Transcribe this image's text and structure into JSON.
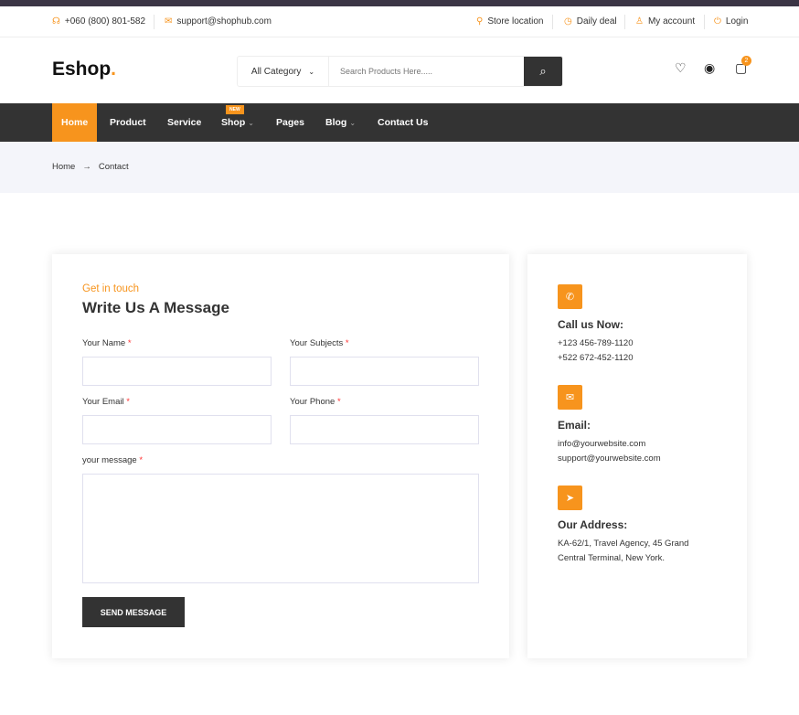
{
  "topbar": {
    "phone": "+060 (800) 801-582",
    "email": "support@shophub.com",
    "store": "Store location",
    "deal": "Daily deal",
    "account": "My account",
    "login": "Login"
  },
  "header": {
    "logo": "Eshop",
    "logo_dot": ".",
    "category": "All Category",
    "search_placeholder": "Search Products Here.....",
    "cart_count": "2"
  },
  "nav": {
    "items": [
      "Home",
      "Product",
      "Service",
      "Shop",
      "Pages",
      "Blog",
      "Contact Us"
    ],
    "new_badge": "NEW"
  },
  "breadcrumb": {
    "home": "Home",
    "sep": "→",
    "current": "Contact"
  },
  "form": {
    "kicker": "Get in touch",
    "title": "Write Us A Message",
    "name": "Your Name",
    "subjects": "Your Subjects",
    "email": "Your Email",
    "phone": "Your Phone",
    "message": "your message",
    "required": "*",
    "send": "SEND MESSAGE"
  },
  "info": {
    "call_title": "Call us Now:",
    "phone1": "+123 456-789-1120",
    "phone2": "+522 672-452-1120",
    "email_title": "Email:",
    "email1": "info@yourwebsite.com",
    "email2": "support@yourwebsite.com",
    "address_title": "Our Address:",
    "address1": "KA-62/1, Travel Agency, 45 Grand",
    "address2": "Central Terminal, New York."
  },
  "colors": {
    "accent": "#f7941d",
    "dark": "#333333"
  }
}
